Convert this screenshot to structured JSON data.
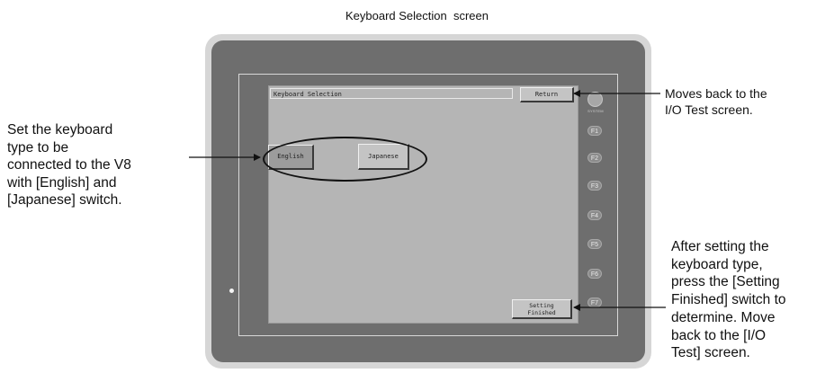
{
  "figure_title": "Keyboard Selection  screen",
  "screen": {
    "title_bar_label": "Keyboard Selection",
    "return_button_label": "Return",
    "english_button_label": "English",
    "japanese_button_label": "Japanese",
    "setting_finished_label_line1": "Setting",
    "setting_finished_label_line2": "Finished"
  },
  "panel": {
    "system_label": "SYSTEM",
    "function_keys": [
      "F1",
      "F2",
      "F3",
      "F4",
      "F5",
      "F6",
      "F7"
    ]
  },
  "annotations": {
    "left_lines": [
      "Set the keyboard",
      "type to be",
      "connected to the V8",
      "with [English] and",
      "[Japanese] switch."
    ],
    "return_lines": [
      "Moves back to the",
      "I/O Test screen."
    ],
    "setting_lines": [
      "After setting the",
      "keyboard type,",
      "press the [Setting",
      "Finished] switch to",
      "determine.  Move",
      "back to the [I/O",
      "Test] screen."
    ]
  },
  "colors": {
    "bezel": "#d6d6d6",
    "body": "#6e6e6e",
    "screen": "#b5b5b5",
    "arrow": "#111111"
  }
}
